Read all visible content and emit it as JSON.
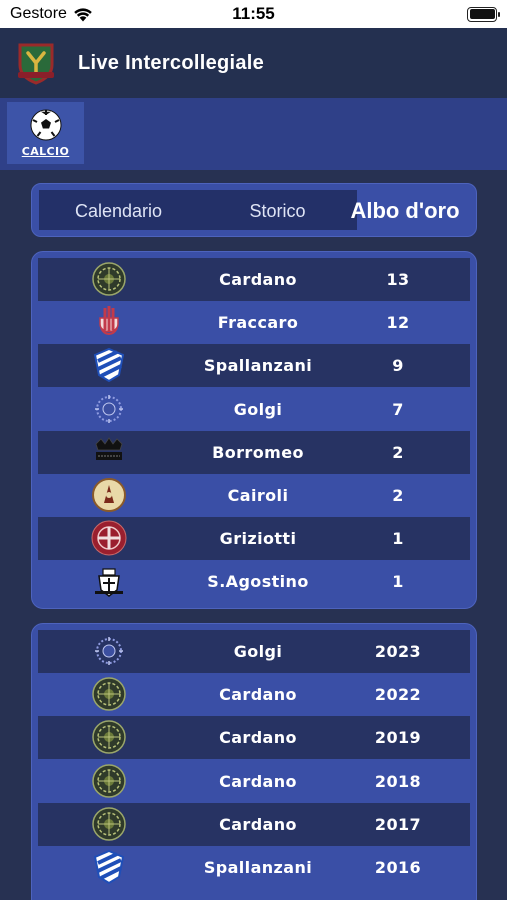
{
  "status_bar": {
    "carrier": "Gestore",
    "time": "11:55"
  },
  "header": {
    "title": "Live Intercollegiale"
  },
  "sport_tabs": [
    {
      "label": "CALCIO",
      "icon": "soccer-ball-icon"
    }
  ],
  "segments": [
    {
      "label": "Calendario",
      "selected": false
    },
    {
      "label": "Storico",
      "selected": false
    },
    {
      "label": "Albo d'oro",
      "selected": true
    }
  ],
  "ranking": [
    {
      "college": "Cardano",
      "titles": "13",
      "crest": "cardano-crest-icon"
    },
    {
      "college": "Fraccaro",
      "titles": "12",
      "crest": "fraccaro-crest-icon"
    },
    {
      "college": "Spallanzani",
      "titles": "9",
      "crest": "spallanzani-crest-icon"
    },
    {
      "college": "Golgi",
      "titles": "7",
      "crest": "golgi-crest-icon"
    },
    {
      "college": "Borromeo",
      "titles": "2",
      "crest": "borromeo-crest-icon"
    },
    {
      "college": "Cairoli",
      "titles": "2",
      "crest": "cairoli-crest-icon"
    },
    {
      "college": "Griziotti",
      "titles": "1",
      "crest": "griziotti-crest-icon"
    },
    {
      "college": "S.Agostino",
      "titles": "1",
      "crest": "sagostino-crest-icon"
    }
  ],
  "winners": [
    {
      "college": "Golgi",
      "year": "2023",
      "crest": "golgi-crest-icon"
    },
    {
      "college": "Cardano",
      "year": "2022",
      "crest": "cardano-crest-icon"
    },
    {
      "college": "Cardano",
      "year": "2019",
      "crest": "cardano-crest-icon"
    },
    {
      "college": "Cardano",
      "year": "2018",
      "crest": "cardano-crest-icon"
    },
    {
      "college": "Cardano",
      "year": "2017",
      "crest": "cardano-crest-icon"
    },
    {
      "college": "Spallanzani",
      "year": "2016",
      "crest": "spallanzani-crest-icon"
    }
  ]
}
